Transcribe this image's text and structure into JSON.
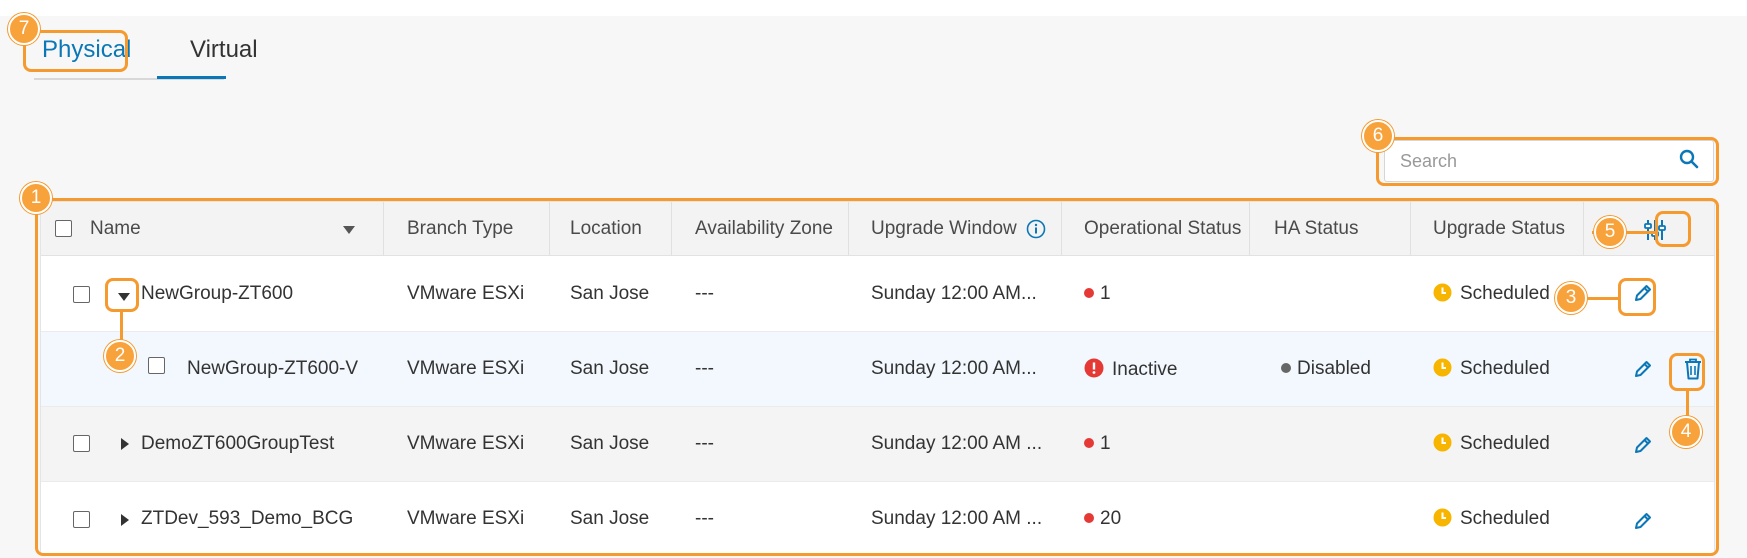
{
  "tabs": [
    {
      "label": "Physical",
      "active": false
    },
    {
      "label": "Virtual",
      "active": true
    }
  ],
  "search": {
    "placeholder": "Search"
  },
  "table": {
    "headers": {
      "name": "Name",
      "branch_type": "Branch Type",
      "location": "Location",
      "availability_zone": "Availability Zone",
      "upgrade_window": "Upgrade Window",
      "operational_status": "Operational Status",
      "ha_status": "HA Status",
      "upgrade_status": "Upgrade Status"
    },
    "rows": [
      {
        "name": "NewGroup-ZT600",
        "branch_type": "VMware ESXi",
        "location": "San Jose",
        "availability_zone": "---",
        "upgrade_window": "Sunday 12:00 AM...",
        "operational_status": "1",
        "ha_status": "",
        "upgrade_status": "Scheduled",
        "expanded": true
      },
      {
        "name": "NewGroup-ZT600-V",
        "branch_type": "VMware ESXi",
        "location": "San Jose",
        "availability_zone": "---",
        "upgrade_window": "Sunday 12:00 AM...",
        "operational_status": "Inactive",
        "ha_status": "Disabled",
        "upgrade_status": "Scheduled",
        "child": true
      },
      {
        "name": "DemoZT600GroupTest",
        "branch_type": "VMware ESXi",
        "location": "San Jose",
        "availability_zone": "---",
        "upgrade_window": "Sunday 12:00 AM ...",
        "operational_status": "1",
        "ha_status": "",
        "upgrade_status": "Scheduled"
      },
      {
        "name": "ZTDev_593_Demo_BCG",
        "branch_type": "VMware ESXi",
        "location": "San Jose",
        "availability_zone": "---",
        "upgrade_window": "Sunday 12:00 AM ...",
        "operational_status": "20",
        "ha_status": "",
        "upgrade_status": "Scheduled"
      }
    ]
  },
  "callouts": [
    "1",
    "2",
    "3",
    "4",
    "5",
    "6",
    "7"
  ],
  "colors": {
    "accent": "#0b77b6",
    "callout": "#f59a2e",
    "status_red": "#e53935",
    "status_gray": "#666666",
    "scheduled": "#f7b500"
  },
  "icons": [
    "search-icon",
    "info-icon",
    "column-settings-icon",
    "edit-icon",
    "delete-icon",
    "caret-down-icon",
    "caret-right-icon",
    "sort-down-icon",
    "error-icon",
    "clock-icon"
  ]
}
